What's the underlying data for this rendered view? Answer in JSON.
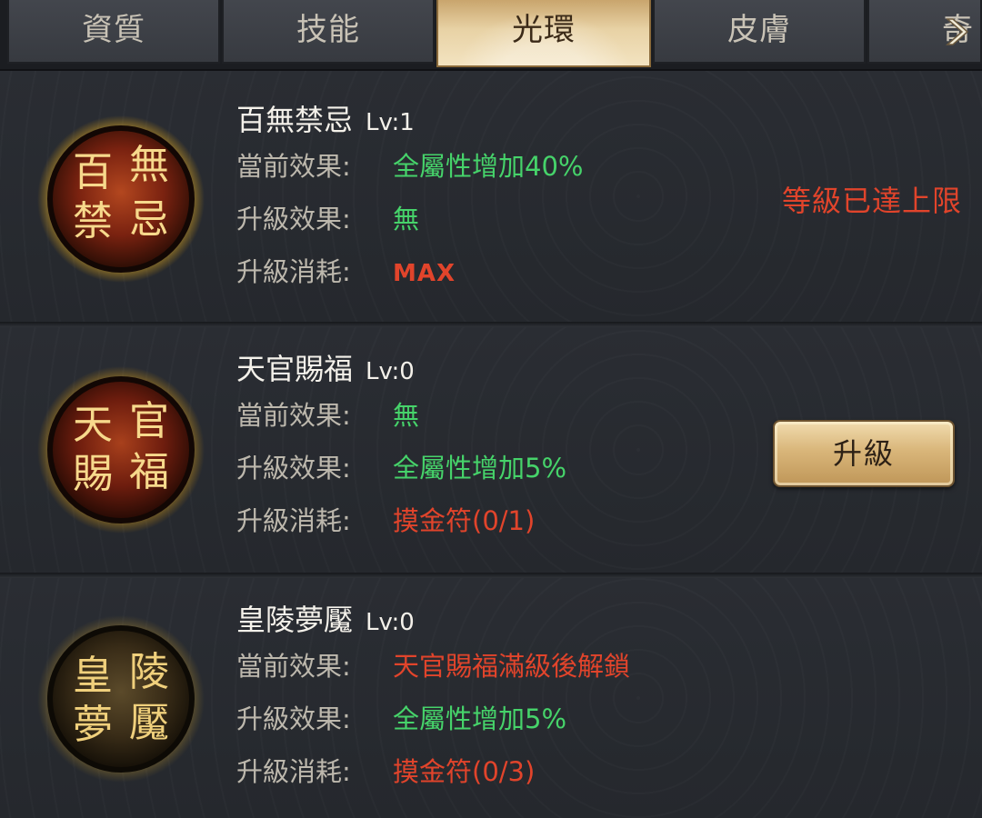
{
  "tabs": [
    {
      "label": "資質",
      "active": false
    },
    {
      "label": "技能",
      "active": false
    },
    {
      "label": "光環",
      "active": true
    },
    {
      "label": "皮膚",
      "active": false
    },
    {
      "label": "奇珍",
      "active": false
    }
  ],
  "skills": [
    {
      "name": "百無禁忌",
      "level": "Lv:1",
      "medal_text": [
        "百",
        "無",
        "禁",
        "忌"
      ],
      "current_label": "當前效果:",
      "current_value": "全屬性增加40%",
      "upgrade_label": "升級效果:",
      "upgrade_value": "無",
      "cost_label": "升級消耗:",
      "cost_value": "MAX",
      "status": "等級已達上限"
    },
    {
      "name": "天官賜福",
      "level": "Lv:0",
      "medal_text": [
        "天",
        "官",
        "賜",
        "福"
      ],
      "current_label": "當前效果:",
      "current_value": "無",
      "upgrade_label": "升級效果:",
      "upgrade_value": "全屬性增加5%",
      "cost_label": "升級消耗:",
      "cost_value": "摸金符(0/1)",
      "button_label": "升級"
    },
    {
      "name": "皇陵夢魘",
      "level": "Lv:0",
      "medal_text": [
        "皇",
        "陵",
        "夢",
        "魘"
      ],
      "current_label": "當前效果:",
      "current_value": "天官賜福滿級後解鎖",
      "upgrade_label": "升級效果:",
      "upgrade_value": "全屬性增加5%",
      "cost_label": "升級消耗:",
      "cost_value": "摸金符(0/3)"
    }
  ],
  "colors": {
    "green": "#46d36a",
    "red": "#e1442b",
    "gold": "#e9c27a"
  }
}
